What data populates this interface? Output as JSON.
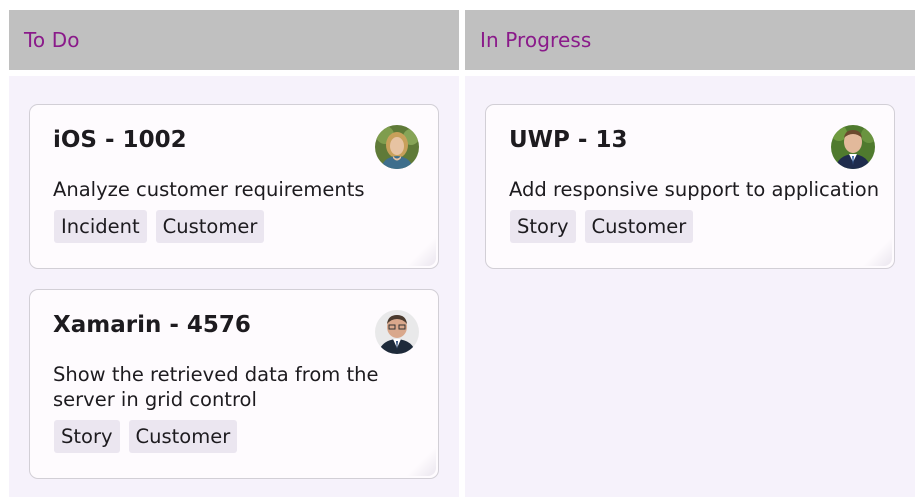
{
  "columns": [
    {
      "title": "To Do",
      "cards": [
        {
          "title": "iOS - 1002",
          "description": "Analyze customer requirements",
          "tags": [
            "Incident",
            "Customer"
          ],
          "avatar": "woman-avatar"
        },
        {
          "title": "Xamarin - 4576",
          "description": "Show the retrieved data from the server in grid control",
          "tags": [
            "Story",
            "Customer"
          ],
          "avatar": "man-glasses-avatar"
        }
      ]
    },
    {
      "title": "In Progress",
      "cards": [
        {
          "title": "UWP - 13",
          "description": "Add responsive support to application",
          "tags": [
            "Story",
            "Customer"
          ],
          "avatar": "man-suit-avatar"
        }
      ]
    }
  ],
  "colors": {
    "header_bg": "#c0c0c0",
    "header_text": "#8a1a8a",
    "column_bg": "#f6f2fb",
    "card_bg": "#fefbfe",
    "tag_bg": "#ebe6f0"
  }
}
